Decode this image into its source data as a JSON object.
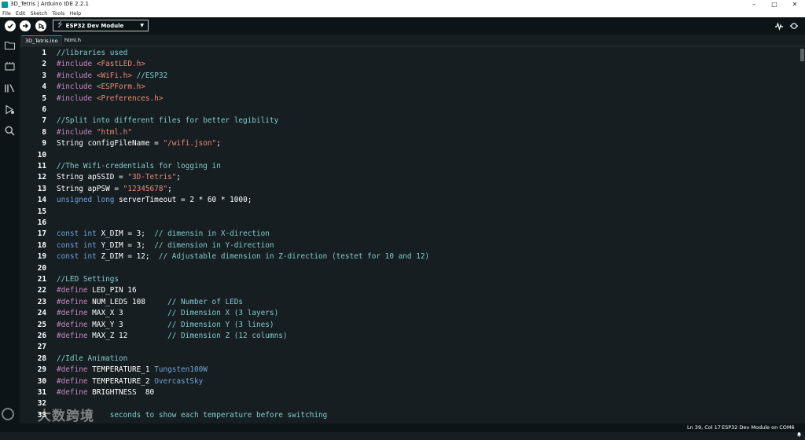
{
  "window": {
    "title": "3D_Tetris | Arduino IDE 2.2.1",
    "minimize": "–",
    "maximize": "□",
    "close": "✕"
  },
  "menu": [
    "File",
    "Edit",
    "Sketch",
    "Tools",
    "Help"
  ],
  "toolbar": {
    "board": "ESP32 Dev Module"
  },
  "tabs": [
    "3D_Tetris.ino",
    "html.h"
  ],
  "colors": {
    "comment": "#7fcbcd",
    "keyword": "#6ea0d8",
    "string": "#e98a73",
    "define": "#c586c0",
    "ident": "#ffffff",
    "accent": "#00979d"
  },
  "code": [
    {
      "n": "1",
      "tokens": [
        [
          "//libraries used",
          "comment"
        ]
      ]
    },
    {
      "n": "2",
      "tokens": [
        [
          "#include ",
          "define"
        ],
        [
          "<FastLED.h>",
          "string"
        ]
      ]
    },
    {
      "n": "3",
      "tokens": [
        [
          "#include ",
          "define"
        ],
        [
          "<WiFi.h>",
          "string"
        ],
        [
          " //ESP32",
          "comment"
        ]
      ]
    },
    {
      "n": "4",
      "tokens": [
        [
          "#include ",
          "define"
        ],
        [
          "<ESPForm.h>",
          "string"
        ]
      ]
    },
    {
      "n": "5",
      "tokens": [
        [
          "#include ",
          "define"
        ],
        [
          "<Preferences.h>",
          "string"
        ]
      ]
    },
    {
      "n": "6",
      "tokens": []
    },
    {
      "n": "7",
      "tokens": [
        [
          "//Split into different files for better legibility",
          "comment"
        ]
      ]
    },
    {
      "n": "8",
      "tokens": [
        [
          "#include ",
          "define"
        ],
        [
          "\"html.h\"",
          "string"
        ]
      ]
    },
    {
      "n": "9",
      "tokens": [
        [
          "String configFileName = ",
          "ident"
        ],
        [
          "\"/wifi.json\"",
          "string"
        ],
        [
          ";",
          "ident"
        ]
      ]
    },
    {
      "n": "10",
      "tokens": []
    },
    {
      "n": "11",
      "tokens": [
        [
          "//The Wifi-credentials for logging in",
          "comment"
        ]
      ]
    },
    {
      "n": "12",
      "tokens": [
        [
          "String apSSID = ",
          "ident"
        ],
        [
          "\"3D-Tetris\"",
          "string"
        ],
        [
          ";",
          "ident"
        ]
      ]
    },
    {
      "n": "13",
      "tokens": [
        [
          "String apPSW = ",
          "ident"
        ],
        [
          "\"12345678\"",
          "string"
        ],
        [
          ";",
          "ident"
        ]
      ]
    },
    {
      "n": "14",
      "tokens": [
        [
          "unsigned long ",
          "keyword"
        ],
        [
          "serverTimeout = 2 * 60 * 1000;",
          "ident"
        ]
      ]
    },
    {
      "n": "15",
      "tokens": []
    },
    {
      "n": "16",
      "tokens": []
    },
    {
      "n": "17",
      "tokens": [
        [
          "const int ",
          "keyword"
        ],
        [
          "X_DIM = 3;  ",
          "ident"
        ],
        [
          "// dimensin in X-direction",
          "comment"
        ]
      ]
    },
    {
      "n": "18",
      "tokens": [
        [
          "const int ",
          "keyword"
        ],
        [
          "Y_DIM = 3;  ",
          "ident"
        ],
        [
          "// dimension in Y-direction",
          "comment"
        ]
      ]
    },
    {
      "n": "19",
      "tokens": [
        [
          "const int ",
          "keyword"
        ],
        [
          "Z_DIM = 12;  ",
          "ident"
        ],
        [
          "// Adjustable dimension in Z-direction (testet for 10 and 12)",
          "comment"
        ]
      ]
    },
    {
      "n": "20",
      "tokens": []
    },
    {
      "n": "21",
      "tokens": [
        [
          "//LED Settings",
          "comment"
        ]
      ]
    },
    {
      "n": "22",
      "tokens": [
        [
          "#define ",
          "define"
        ],
        [
          "LED_PIN 16",
          "ident"
        ]
      ]
    },
    {
      "n": "23",
      "tokens": [
        [
          "#define ",
          "define"
        ],
        [
          "NUM_LEDS 108     ",
          "ident"
        ],
        [
          "// Number of LEDs",
          "comment"
        ]
      ]
    },
    {
      "n": "24",
      "tokens": [
        [
          "#define ",
          "define"
        ],
        [
          "MAX_X 3          ",
          "ident"
        ],
        [
          "// Dimension X (3 layers)",
          "comment"
        ]
      ]
    },
    {
      "n": "25",
      "tokens": [
        [
          "#define ",
          "define"
        ],
        [
          "MAX_Y 3          ",
          "ident"
        ],
        [
          "// Dimension Y (3 lines)",
          "comment"
        ]
      ]
    },
    {
      "n": "26",
      "tokens": [
        [
          "#define ",
          "define"
        ],
        [
          "MAX_Z 12         ",
          "ident"
        ],
        [
          "// Dimension Z (12 columns)",
          "comment"
        ]
      ]
    },
    {
      "n": "27",
      "tokens": []
    },
    {
      "n": "28",
      "tokens": [
        [
          "//Idle Animation",
          "comment"
        ]
      ]
    },
    {
      "n": "29",
      "tokens": [
        [
          "#define ",
          "define"
        ],
        [
          "TEMPERATURE_1 ",
          "ident"
        ],
        [
          "Tungsten100W",
          "keyword"
        ]
      ]
    },
    {
      "n": "30",
      "tokens": [
        [
          "#define ",
          "define"
        ],
        [
          "TEMPERATURE_2 ",
          "ident"
        ],
        [
          "OvercastSky",
          "keyword"
        ]
      ]
    },
    {
      "n": "31",
      "tokens": [
        [
          "#define ",
          "define"
        ],
        [
          "BRIGHTNESS  80",
          "ident"
        ]
      ]
    },
    {
      "n": "32",
      "tokens": []
    },
    {
      "n": "33",
      "tokens": [
        [
          "            seconds to show each temperature before switching",
          "comment"
        ]
      ]
    }
  ],
  "watermark": "大数跨境",
  "status": {
    "cursor": "Ln 39, Col 17",
    "board_port": "ESP32 Dev Module on COM6"
  }
}
